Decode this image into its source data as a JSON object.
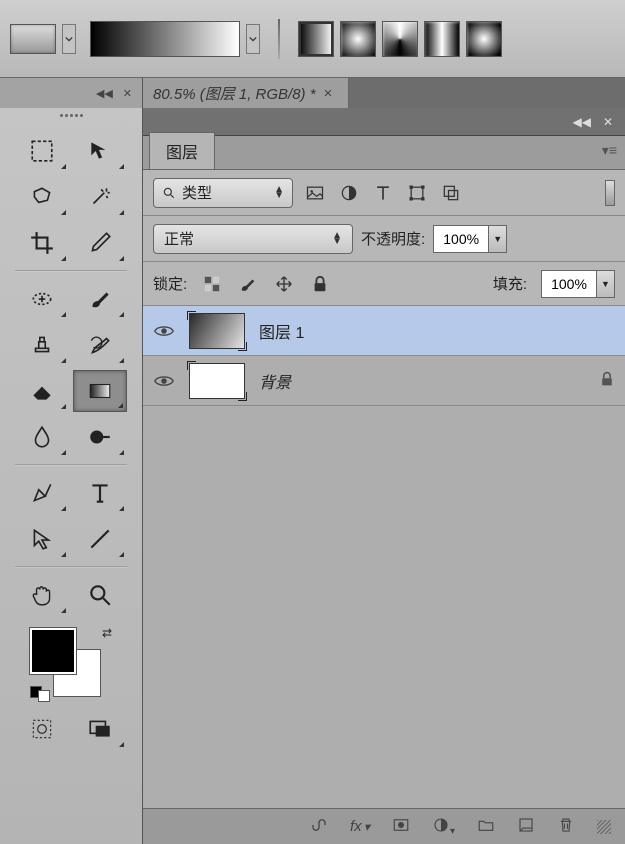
{
  "document_tab": {
    "title": "80.5% (图层 1, RGB/8) *"
  },
  "panel": {
    "title": "图层",
    "kind_label": "类型",
    "blend_mode": "正常",
    "opacity_label": "不透明度:",
    "opacity_value": "100%",
    "lock_label": "锁定:",
    "fill_label": "填充:",
    "fill_value": "100%"
  },
  "layers": [
    {
      "name": "图层 1",
      "selected": true,
      "thumb": "grad",
      "locked": false
    },
    {
      "name": "背景",
      "selected": false,
      "thumb": "white",
      "locked": true
    }
  ],
  "gradient_types": [
    "linear",
    "radial",
    "angle",
    "reflected",
    "diamond"
  ],
  "filter_icons": [
    "image-icon",
    "adjustment-icon",
    "type-icon",
    "shape-icon",
    "smartobject-icon"
  ],
  "lock_icons": [
    "lock-pixels-icon",
    "lock-brush-icon",
    "lock-position-icon",
    "lock-all-icon"
  ],
  "footer_icons": [
    "link-icon",
    "fx-icon",
    "mask-icon",
    "adjust-layer-icon",
    "group-icon",
    "new-layer-icon",
    "trash-icon"
  ],
  "colors": {
    "foreground": "#000000",
    "background": "#ffffff"
  }
}
